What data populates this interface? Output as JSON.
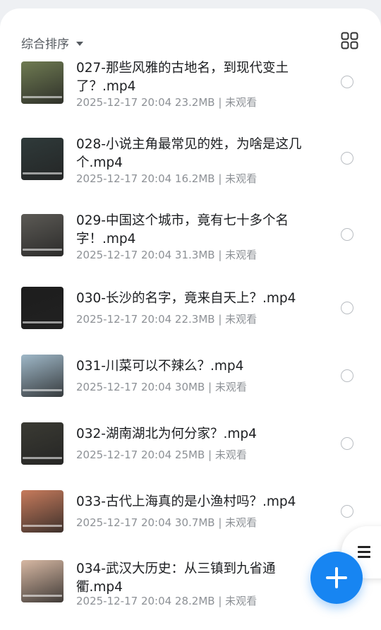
{
  "sort": {
    "label": "综合排序"
  },
  "files": [
    {
      "title": "027-那些风雅的古地名，到现代变土了？.mp4",
      "meta": "2025-12-17 20:04  23.2MB | 未观看",
      "thumb": "#6f7b52"
    },
    {
      "title": "028-小说主角最常见的姓，为啥是这几个.mp4",
      "meta": "2025-12-17 20:04  16.2MB | 未观看",
      "thumb": "#2f3a3a"
    },
    {
      "title": "029-中国这个城市，竟有七十多个名字！.mp4",
      "meta": "2025-12-17 20:04  31.3MB | 未观看",
      "thumb": "#5c5a55"
    },
    {
      "title": "030-长沙的名字，竟来自天上？.mp4",
      "meta": "2025-12-17 20:04  22.3MB | 未观看",
      "thumb": "#1d1d1d"
    },
    {
      "title": "031-川菜可以不辣么？.mp4",
      "meta": "2025-12-17 20:04  30MB | 未观看",
      "thumb": "#9fb8c8"
    },
    {
      "title": "032-湖南湖北为何分家？.mp4",
      "meta": "2025-12-17 20:04  25MB | 未观看",
      "thumb": "#3a3a33"
    },
    {
      "title": "033-古代上海真的是小渔村吗？.mp4",
      "meta": "2025-12-17 20:04  30.7MB | 未观看",
      "thumb": "#c77b5c"
    },
    {
      "title": "034-武汉大历史：从三镇到九省通衢.mp4",
      "meta": "2025-12-17 20:04  28.2MB | 未观看",
      "thumb": "#d7b8a3"
    }
  ],
  "colors": {
    "accent": "#1785f2",
    "text": "#1c1e21",
    "muted": "#8d9196"
  },
  "icons": {
    "grid": "grid-view-icon",
    "menu": "menu-icon",
    "add": "plus-icon"
  }
}
